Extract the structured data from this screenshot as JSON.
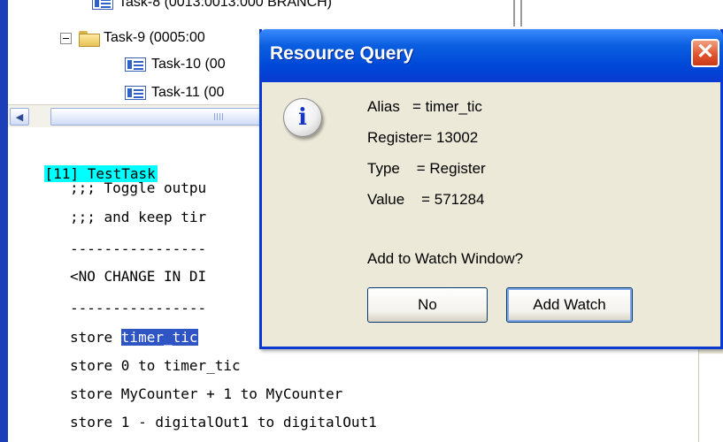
{
  "tree": {
    "rows": [
      {
        "label": "Task-8 (0013:0013:000 BRANCH)",
        "icon": "task-icon"
      },
      {
        "label": "Task-9 (0005:00",
        "icon": "folder-icon",
        "expander": "collapse-icon"
      },
      {
        "label": "Task-10 (00",
        "icon": "task-icon"
      },
      {
        "label": "Task-11 (00",
        "icon": "task-icon"
      }
    ]
  },
  "scrollbar": {
    "left_arrow": "◀"
  },
  "code": {
    "header": "[11] TestTask",
    "lines": [
      ";;; Toggle outpu",
      ";;; and keep tir",
      "----------------",
      "<NO CHANGE IN DI",
      "----------------"
    ],
    "store_prefix": "store ",
    "store_selected": "timer_tic",
    "lines_after": [
      "store 0 to timer_tic",
      "store MyCounter + 1 to MyCounter",
      "store 1 - digitalOut1 to digitalOut1"
    ]
  },
  "dialog": {
    "title": "Resource Query",
    "close_glyph": "✕",
    "icon_glyph": "i",
    "alias": "Alias   = timer_tic",
    "register": "Register= 13002",
    "type": "Type    = Register",
    "value": "Value    = 571284",
    "question": "Add to Watch Window?",
    "no_label": "No",
    "add_label": "Add Watch"
  },
  "colors": {
    "title_bar": "#0048d8",
    "header_highlight": "#00ffff",
    "selection": "#2f55c4",
    "close_button": "#e0502a"
  }
}
